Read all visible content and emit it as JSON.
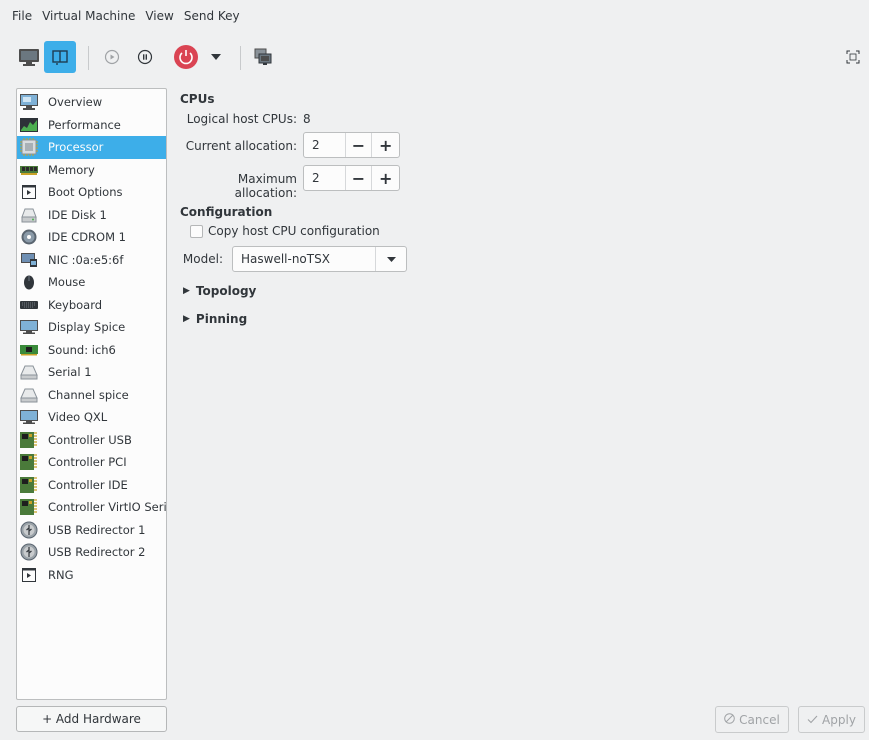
{
  "menubar": {
    "items": [
      "File",
      "Virtual Machine",
      "View",
      "Send Key"
    ]
  },
  "toolbar": {
    "buttons": [
      {
        "name": "console-view",
        "icon": "monitor-icon",
        "active": false
      },
      {
        "name": "details-view",
        "icon": "info-book-icon",
        "active": true
      },
      {
        "name": "run",
        "icon": "play-icon",
        "active": false
      },
      {
        "name": "pause",
        "icon": "pause-icon",
        "active": false
      },
      {
        "name": "shutdown",
        "icon": "power-icon",
        "active": false
      },
      {
        "name": "shutdown-menu",
        "icon": "dropdown-arrow-icon",
        "active": false
      },
      {
        "name": "snapshots",
        "icon": "snapshot-icon",
        "active": false
      },
      {
        "name": "fullscreen",
        "icon": "fullscreen-icon",
        "active": false
      }
    ],
    "power_color": "#da4453",
    "accent_color": "#3daee9"
  },
  "sidebar": {
    "items": [
      {
        "label": "Overview",
        "icon": "overview-icon"
      },
      {
        "label": "Performance",
        "icon": "performance-icon"
      },
      {
        "label": "Processor",
        "icon": "cpu-icon",
        "selected": true
      },
      {
        "label": "Memory",
        "icon": "memory-icon"
      },
      {
        "label": "Boot Options",
        "icon": "boot-icon"
      },
      {
        "label": "IDE Disk 1",
        "icon": "disk-icon"
      },
      {
        "label": "IDE CDROM 1",
        "icon": "cdrom-icon"
      },
      {
        "label": "NIC :0a:e5:6f",
        "icon": "nic-icon"
      },
      {
        "label": "Mouse",
        "icon": "mouse-icon"
      },
      {
        "label": "Keyboard",
        "icon": "keyboard-icon"
      },
      {
        "label": "Display Spice",
        "icon": "display-icon"
      },
      {
        "label": "Sound: ich6",
        "icon": "sound-icon"
      },
      {
        "label": "Serial 1",
        "icon": "serial-icon"
      },
      {
        "label": "Channel spice",
        "icon": "channel-icon"
      },
      {
        "label": "Video QXL",
        "icon": "video-icon"
      },
      {
        "label": "Controller USB",
        "icon": "controller-icon"
      },
      {
        "label": "Controller PCI",
        "icon": "controller-icon"
      },
      {
        "label": "Controller IDE",
        "icon": "controller-icon"
      },
      {
        "label": "Controller VirtIO Serial",
        "icon": "controller-icon"
      },
      {
        "label": "USB Redirector 1",
        "icon": "usb-redirector-icon"
      },
      {
        "label": "USB Redirector 2",
        "icon": "usb-redirector-icon"
      },
      {
        "label": "RNG",
        "icon": "rng-icon"
      }
    ],
    "add_hardware_label": "+ Add Hardware"
  },
  "main": {
    "cpus": {
      "title": "CPUs",
      "logical_label": "Logical host CPUs:",
      "logical_value": "8",
      "current_label": "Current allocation:",
      "current_value": "2",
      "maximum_label": "Maximum allocation:",
      "maximum_value": "2",
      "minus": "−",
      "plus": "+"
    },
    "configuration": {
      "title": "Configuration",
      "copy_host_label": "Copy host CPU configuration",
      "copy_host_checked": false,
      "model_label": "Model:",
      "model_value": "Haswell-noTSX"
    },
    "topology_label": "Topology",
    "pinning_label": "Pinning"
  },
  "footer": {
    "cancel_label": "Cancel",
    "apply_label": "Apply"
  }
}
